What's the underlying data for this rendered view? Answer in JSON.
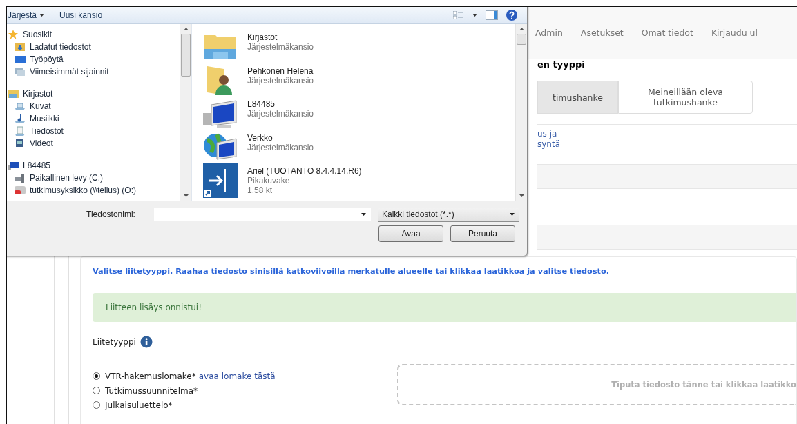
{
  "page": {
    "nav": [
      {
        "label": "Admin"
      },
      {
        "label": "Asetukset"
      },
      {
        "label": "Omat tiedot"
      },
      {
        "label": "Kirjaudu ul"
      }
    ],
    "heading_fragment": "en tyyppi",
    "tabs": [
      {
        "label": "timushanke",
        "selected": true
      },
      {
        "label": "Meineillään oleva tutkimushanke",
        "selected": false
      }
    ],
    "link_fragment": [
      "us ja",
      "syntä"
    ],
    "instructions": "Valitse liitetyyppi. Raahaa tiedosto sinisillä katkoviivoilla merkatulle alueelle tai klikkaa laatikkoa ja valitse tiedosto.",
    "alert": "Liitteen lisäys onnistui!",
    "attachment_type_label": "Liitetyyppi",
    "attachment_types": [
      {
        "label": "VTR-hakemuslomake*",
        "link": "avaa lomake tästä",
        "selected": true
      },
      {
        "label": "Tutkimussuunnitelma*",
        "selected": false
      },
      {
        "label": "Julkaisuluettelo*",
        "selected": false
      }
    ],
    "dropzone": "Tiputa tiedosto tänne tai klikkaa laatikko"
  },
  "file_dialog": {
    "toolbar": {
      "organize": "Järjestä",
      "new_folder": "Uusi kansio"
    },
    "navigation": [
      {
        "label": "Suosikit",
        "kind": "star",
        "children": [
          {
            "label": "Ladatut tiedostot",
            "kind": "downloads"
          },
          {
            "label": "Työpöytä",
            "kind": "desktop"
          },
          {
            "label": "Viimeisimmät sijainnit",
            "kind": "recent"
          }
        ]
      },
      {
        "label": "Kirjastot",
        "kind": "library",
        "children": [
          {
            "label": "Kuvat",
            "kind": "pictures"
          },
          {
            "label": "Musiikki",
            "kind": "music"
          },
          {
            "label": "Tiedostot",
            "kind": "documents"
          },
          {
            "label": "Videot",
            "kind": "videos"
          }
        ]
      },
      {
        "label": "L84485",
        "kind": "computer",
        "children": [
          {
            "label": "Paikallinen levy (C:)",
            "kind": "drive"
          },
          {
            "label": "tutkimusyksikko (\\\\tellus) (O:)",
            "kind": "netdrive"
          }
        ]
      }
    ],
    "files": [
      {
        "name": "Kirjastot",
        "type": "Järjestelmäkansio",
        "kind": "library"
      },
      {
        "name": "Pehkonen Helena",
        "type": "Järjestelmäkansio",
        "kind": "user"
      },
      {
        "name": "L84485",
        "type": "Järjestelmäkansio",
        "kind": "computer"
      },
      {
        "name": "Verkko",
        "type": "Järjestelmäkansio",
        "kind": "network"
      },
      {
        "name": "Ariel (TUOTANTO 8.4.4.14.R6)",
        "type": "Pikakuvake",
        "size": "1,58 kt",
        "kind": "shortcut"
      }
    ],
    "file_name_label": "Tiedostonimi:",
    "file_type": "Kaikki tiedostot (*.*)",
    "buttons": [
      {
        "label": "Avaa"
      },
      {
        "label": "Peruuta"
      }
    ]
  }
}
